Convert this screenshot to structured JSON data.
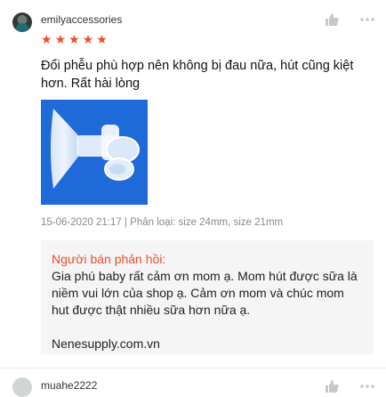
{
  "review": {
    "username": "emilyaccessories",
    "rating": 5,
    "stars": [
      "★",
      "★",
      "★",
      "★",
      "★"
    ],
    "comment": "Đổi phễu phù hợp nên không bị đau nữa, hút cũng kiệt hơn. Rất hài lòng",
    "meta": "15-06-2020 21:17 | Phân loại: size 24mm, size 21mm",
    "seller_reply": {
      "title": "Người bán phản hồi:",
      "text": "Gia phú baby rất cảm ơn mom ạ. Mom hút được sữa là niềm vui lớn của shop ạ. Cảm ơn mom và chúc mom hut được thật nhiều sữa hơn nữa ạ.",
      "site": "Nenesupply.com.vn"
    },
    "icons": {
      "like": "thumbs-up-icon",
      "more": "more-dots-icon"
    }
  },
  "next_review": {
    "username": "muahe2222"
  },
  "colors": {
    "accent": "#ee4d2d",
    "photo_bg": "#1f6ad9",
    "reply_bg": "#f5f5f5",
    "meta_text": "#8a8a8a"
  }
}
